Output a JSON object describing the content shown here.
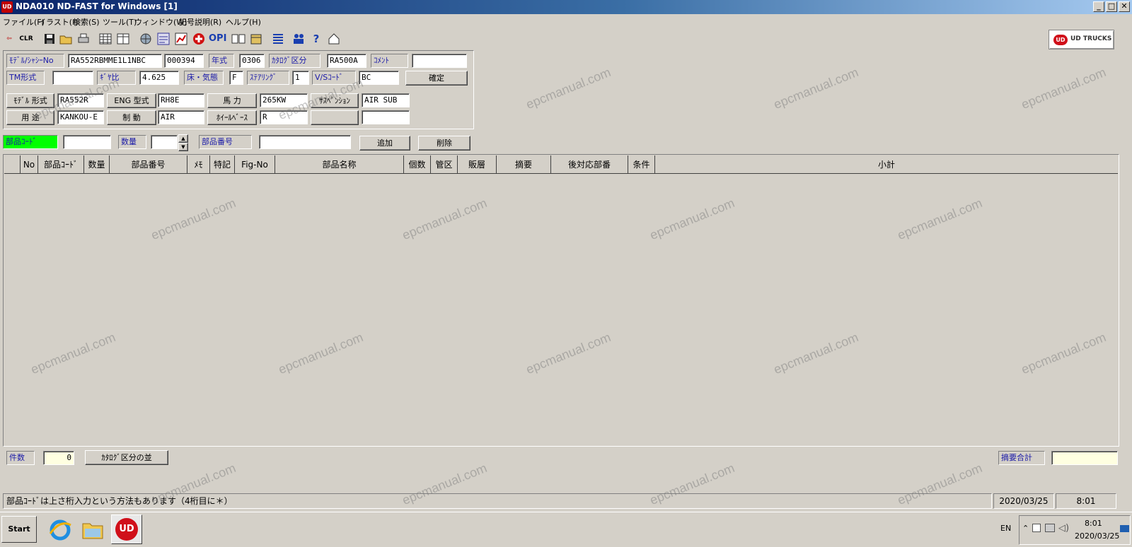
{
  "window": {
    "title": "NDA010 ND-FAST for Windows [1]",
    "app_icon_text": "UD",
    "min_glyph": "_",
    "max_glyph": "□",
    "close_glyph": "✕"
  },
  "menu": [
    "ファイル(F)",
    "イラスト(I)",
    "検索(S)",
    "ツール(T)",
    "ウィンドウ(W)",
    "記号説明(R)",
    "ヘルプ(H)"
  ],
  "toolbar": {
    "icons": [
      "exit-icon",
      "clear-icon",
      "save-icon",
      "open-folder-icon",
      "print-icon",
      "grid-icon",
      "table-icon",
      "globe-icon",
      "catalog-icon",
      "chart-icon",
      "plus-icon",
      "opi-icon",
      "book-icon",
      "archive-icon",
      "list-icon",
      "people-icon",
      "help-icon",
      "home-icon"
    ],
    "clr_label": "CLR",
    "opi_label": "OPI",
    "brand_logo": "UD",
    "brand": "UD TRUCKS"
  },
  "header": {
    "model_chassis_label": "ﾓﾃﾞﾙ/ｼｬｼｰNo",
    "model_chassis_value": "RA552RBMME1L1NBC",
    "serial_value": "000394",
    "year_label": "年式",
    "year_value": "0306",
    "catalog_class_label": "ｶﾀﾛｸﾞ区分",
    "catalog_class_value": "RA500A",
    "comment_label": "ｺﾒﾝﾄ",
    "comment_value": "",
    "tm_label": "TM形式",
    "tm_value": "",
    "gear_ratio_label": "ｷﾞﾔ比",
    "gear_ratio_value": "4.625",
    "floor_climate_label": "床・気態",
    "floor_climate_value": "F",
    "steering_label": "ｽﾃｱﾘﾝｸﾞ",
    "steering_value": "1",
    "vs_code_label": "V/Sｺｰﾄﾞ",
    "vs_code_value": "BC",
    "confirm_button": "確定",
    "model_type_label": "ﾓﾃﾞﾙ 形式",
    "model_type_value": "RA552R",
    "eng_type_label": "ENG 型式",
    "eng_type_value": "RH8E",
    "horsepower_label": "馬 力",
    "horsepower_value": "265KW",
    "suspension_label": "ｻｽﾍﾟﾝｼｮﾝ",
    "suspension_value": "AIR SUB",
    "usage_label": "用 途",
    "usage_value": "KANKOU-E",
    "brake_label": "制 動",
    "brake_value": "AIR",
    "wheelbase_label": "ﾎｲｰﾙﾍﾞｰｽ",
    "wheelbase_value": "R"
  },
  "entry": {
    "part_code_label": "部品ｺｰﾄﾞ",
    "part_code_value": "",
    "qty_label": "数量",
    "qty_value": "",
    "part_no_label": "部品番号",
    "part_no_value": "",
    "add_button": "追加",
    "delete_button": "削除",
    "spin_up": "▲",
    "spin_down": "▼",
    "highlight_color": "#00ff00"
  },
  "table": {
    "columns": [
      "No",
      "部品ｺｰﾄﾞ",
      "数量",
      "部品番号",
      "ﾒﾓ",
      "特記",
      "Fig-No",
      "部品名称",
      "個数",
      "管区",
      "販層",
      "摘要",
      "後対応部番",
      "条件",
      "小計"
    ],
    "rows": []
  },
  "footer": {
    "count_label": "件数",
    "count_value": "0",
    "sort_button": "ｶﾀﾛｸﾞ区分の並",
    "summary_label": "摘要合計",
    "summary_value": ""
  },
  "status": {
    "message": "部品ｺｰﾄﾞは上さ桁入力という方法もあります（4桁目に＊）",
    "date": "2020/03/25",
    "time": "8:01"
  },
  "taskbar": {
    "start": "Start",
    "apps": [
      "internet-explorer-icon",
      "file-explorer-icon",
      "ud-app-icon"
    ],
    "ud_app_text": "UD",
    "language": "EN",
    "tray_chevron": "⌃",
    "time": "8:01",
    "date": "2020/03/25"
  },
  "watermark": "epcmanual.com"
}
